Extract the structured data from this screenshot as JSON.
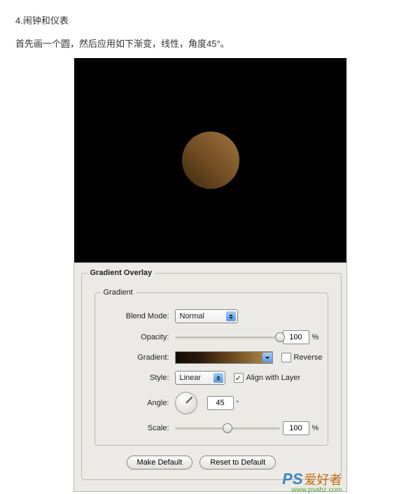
{
  "text": {
    "heading": "4.闹钟和仪表",
    "body": "首先画一个圆，然后应用如下渐变，线性，角度45°。"
  },
  "panel": {
    "groupTitle": "Gradient Overlay",
    "innerTitle": "Gradient",
    "blendMode": {
      "label": "Blend Mode:",
      "value": "Normal"
    },
    "opacity": {
      "label": "Opacity:",
      "value": "100",
      "unit": "%",
      "sliderPos": 100
    },
    "gradient": {
      "label": "Gradient:",
      "reverseLabel": "Reverse",
      "reverseChecked": false
    },
    "style": {
      "label": "Style:",
      "value": "Linear",
      "alignLabel": "Align with Layer",
      "alignChecked": true
    },
    "angle": {
      "label": "Angle:",
      "value": "45"
    },
    "scale": {
      "label": "Scale:",
      "value": "100",
      "unit": "%",
      "sliderPos": 50
    },
    "buttons": {
      "makeDefault": "Make Default",
      "resetDefault": "Reset to Default"
    }
  },
  "watermark": {
    "ps": "PS",
    "zh": "爱好者",
    "url": "www.psahz.com"
  }
}
